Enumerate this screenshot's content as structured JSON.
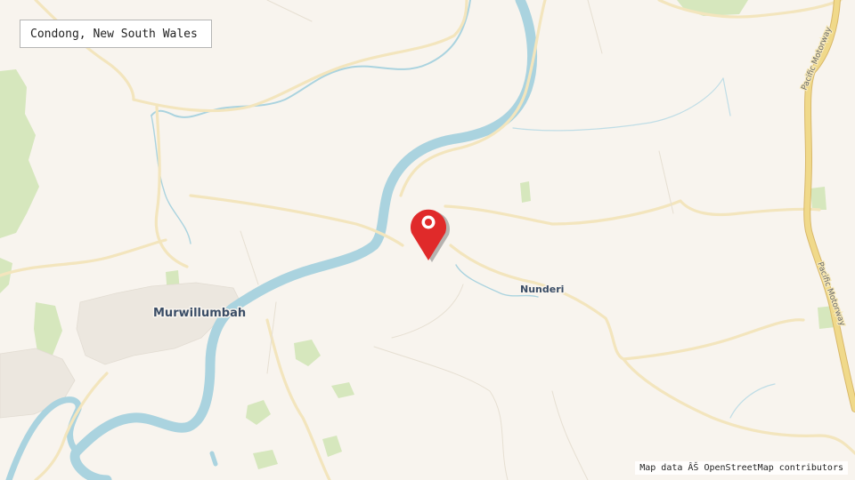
{
  "map": {
    "location_title": "Condong, New South Wales",
    "attribution": "Map data ÂŠ OpenStreetMap contributors",
    "places": {
      "murwillumbah": "Murwillumbah",
      "nunderi": "Nunderi"
    },
    "roads": {
      "pacific_motorway_north": "Pacific Motorway",
      "pacific_motorway_south": "Pacific Motorway"
    },
    "marker_icon": "map-pin-icon",
    "colors": {
      "background": "#f8f4ee",
      "water": "#aad3df",
      "vegetation": "#cfe3b4",
      "minor_road": "#f3e7c2",
      "motorway": "#f0d98a",
      "marker": "#e02a2a"
    }
  }
}
